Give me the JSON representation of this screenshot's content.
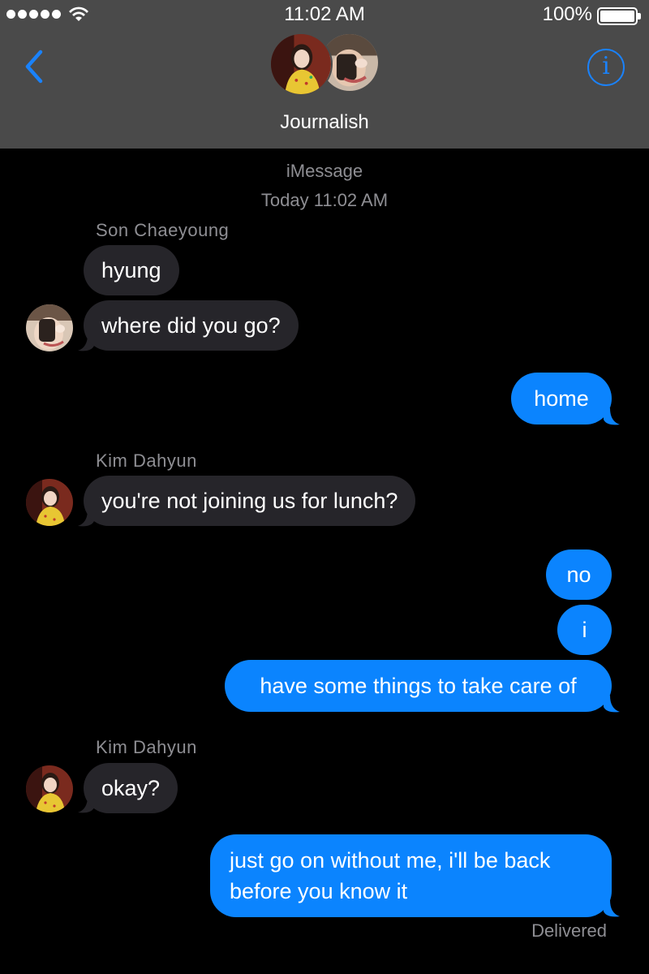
{
  "status_bar": {
    "time": "11:02 AM",
    "battery": "100%"
  },
  "header": {
    "title": "Journalish",
    "back_icon": "chevron-left-icon",
    "info_icon": "info-icon",
    "info_glyph": "i",
    "accent_color": "#1a82fb"
  },
  "conversation": {
    "service": "iMessage",
    "timestamp": "Today 11:02 AM",
    "delivered": "Delivered"
  },
  "senders": {
    "s1": "Son Chaeyoung",
    "s2": "Kim Dahyun",
    "s3": "Kim Dahyun"
  },
  "messages": [
    {
      "from": "Son Chaeyoung",
      "direction": "incoming",
      "text": "hyung"
    },
    {
      "from": "Son Chaeyoung",
      "direction": "incoming",
      "text": "where did you go?"
    },
    {
      "from": "me",
      "direction": "outgoing",
      "text": "home"
    },
    {
      "from": "Kim Dahyun",
      "direction": "incoming",
      "text": "you're not joining us for lunch?"
    },
    {
      "from": "me",
      "direction": "outgoing",
      "text": "no"
    },
    {
      "from": "me",
      "direction": "outgoing",
      "text": "i"
    },
    {
      "from": "me",
      "direction": "outgoing",
      "text": "have some things to take care of"
    },
    {
      "from": "Kim Dahyun",
      "direction": "incoming",
      "text": "okay?"
    },
    {
      "from": "me",
      "direction": "outgoing",
      "text": "just go on without me, i'll be back before you know it"
    }
  ],
  "colors": {
    "header_bg": "#4a4a4a",
    "background": "#000000",
    "incoming_bubble": "#26252a",
    "outgoing_bubble": "#0b84fe",
    "meta_text": "#8e8e93"
  }
}
